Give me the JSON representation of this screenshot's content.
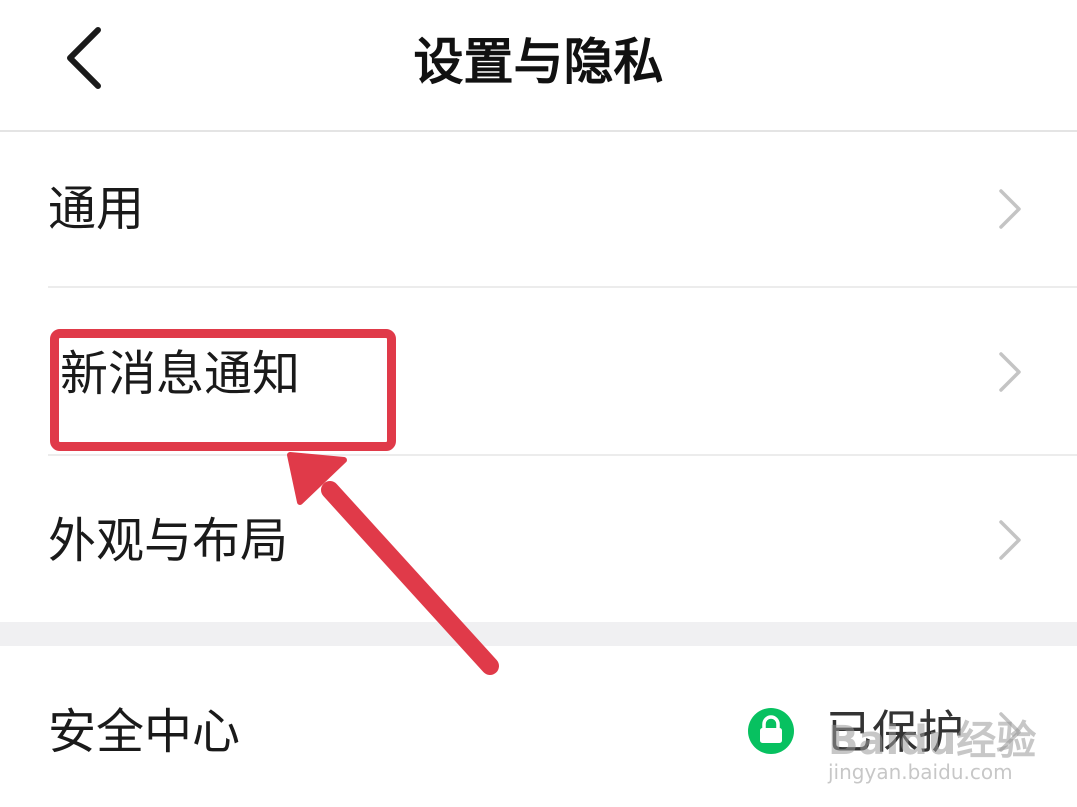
{
  "header": {
    "title": "设置与隐私",
    "back_icon": "chevron-left-icon"
  },
  "settings": {
    "general_label": "通用",
    "notifications_label": "新消息通知",
    "appearance_label": "外观与布局",
    "security_label": "安全中心",
    "security_status": "已保护",
    "row_icon": "chevron-right-icon",
    "status_icon": "lock-icon",
    "status_color": "#07c160"
  },
  "annotation": {
    "highlight_color": "#e03a49"
  },
  "watermark": {
    "logo_text": "Baidu经验",
    "url": "jingyan.baidu.com"
  }
}
